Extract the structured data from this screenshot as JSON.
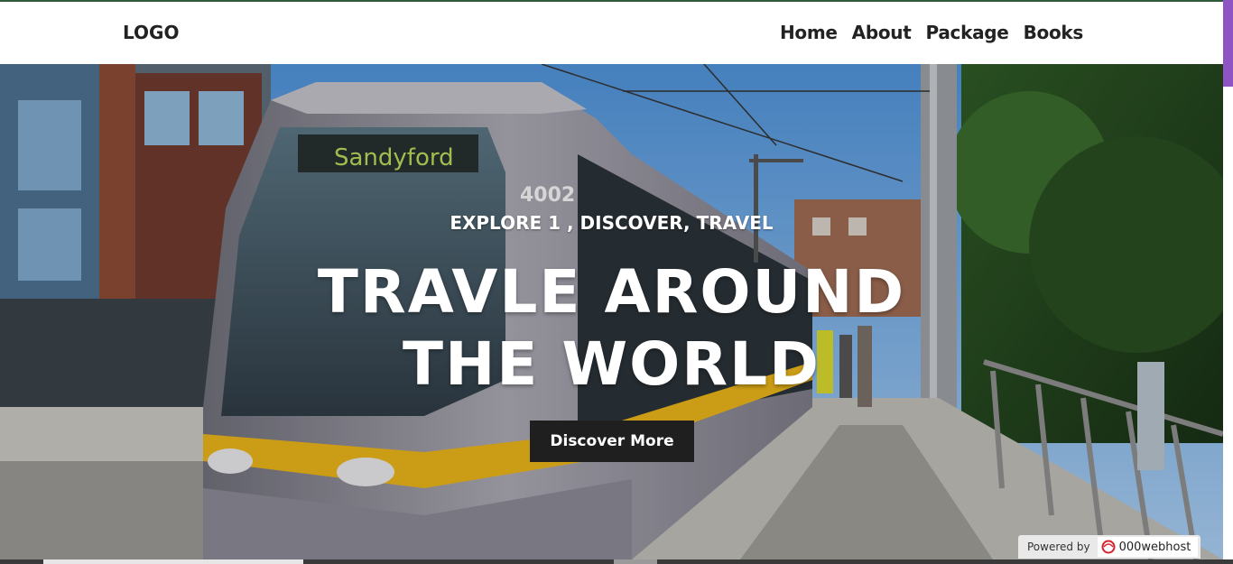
{
  "header": {
    "logo": "LOGO",
    "nav": [
      "Home",
      "About",
      "Package",
      "Books"
    ]
  },
  "hero": {
    "subtitle": "EXPLORE 1 , DISCOVER, TRAVEL",
    "title_line1": "TRAVLE AROUND",
    "title_line2": "THE WORLD",
    "cta_label": "Discover More",
    "image": "tram-street-photo"
  },
  "badge": {
    "prefix": "Powered by",
    "brand": "000webhost",
    "icon": "000webhost-logo-icon"
  },
  "colors": {
    "accent": "#8f54c4",
    "button": "#1f1f1f",
    "tram_yellow": "#e8b21a"
  }
}
